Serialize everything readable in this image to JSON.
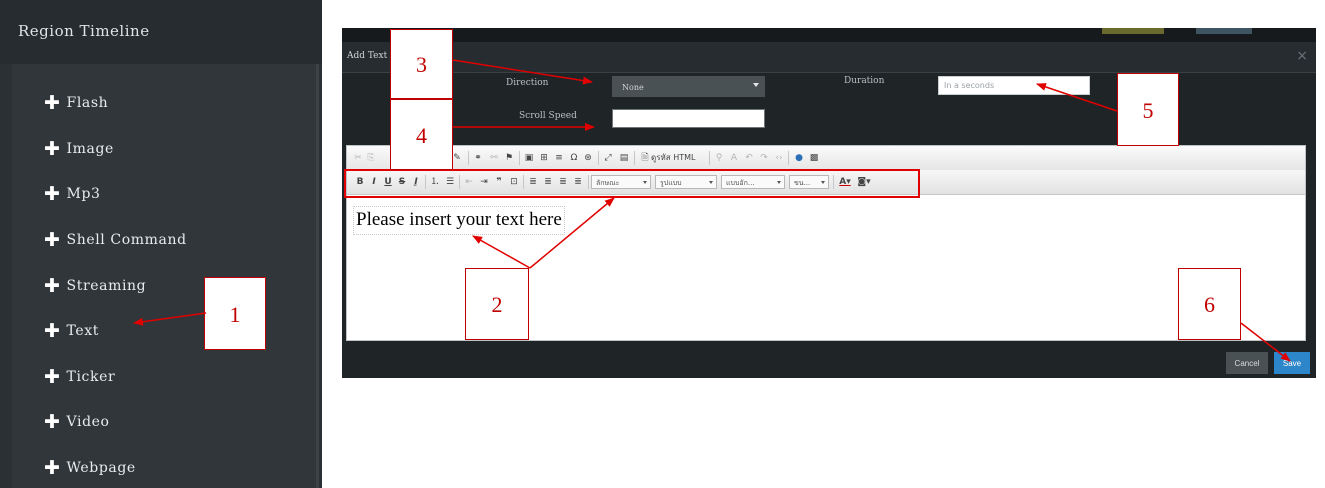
{
  "sidebar": {
    "title": "Region Timeline",
    "items": [
      {
        "label": "Flash"
      },
      {
        "label": "Image"
      },
      {
        "label": "Mp3"
      },
      {
        "label": "Shell Command"
      },
      {
        "label": "Streaming"
      },
      {
        "label": "Text"
      },
      {
        "label": "Ticker"
      },
      {
        "label": "Video"
      },
      {
        "label": "Webpage"
      }
    ]
  },
  "modal": {
    "title": "Add Text",
    "close_glyph": "×",
    "direction": {
      "label": "Direction",
      "value": "None"
    },
    "duration": {
      "label": "Duration",
      "placeholder": "In a seconds"
    },
    "scroll_speed": {
      "label": "Scroll Speed",
      "value": ""
    },
    "editor": {
      "source_label": "ดูรหัส HTML",
      "combos": [
        "ลักษณะ",
        "รูปแบบ",
        "แบบอัก...",
        "ขน..."
      ],
      "content": "Please insert your text here"
    },
    "cancel_label": "Cancel",
    "save_label": "Save"
  },
  "annotations": [
    "1",
    "2",
    "3",
    "4",
    "5",
    "6"
  ],
  "colors": {
    "sidebar_bg": "#30363a",
    "modal_bg": "#1f2427",
    "save_blue": "#2d86c9",
    "annotation_red": "#c00000"
  }
}
